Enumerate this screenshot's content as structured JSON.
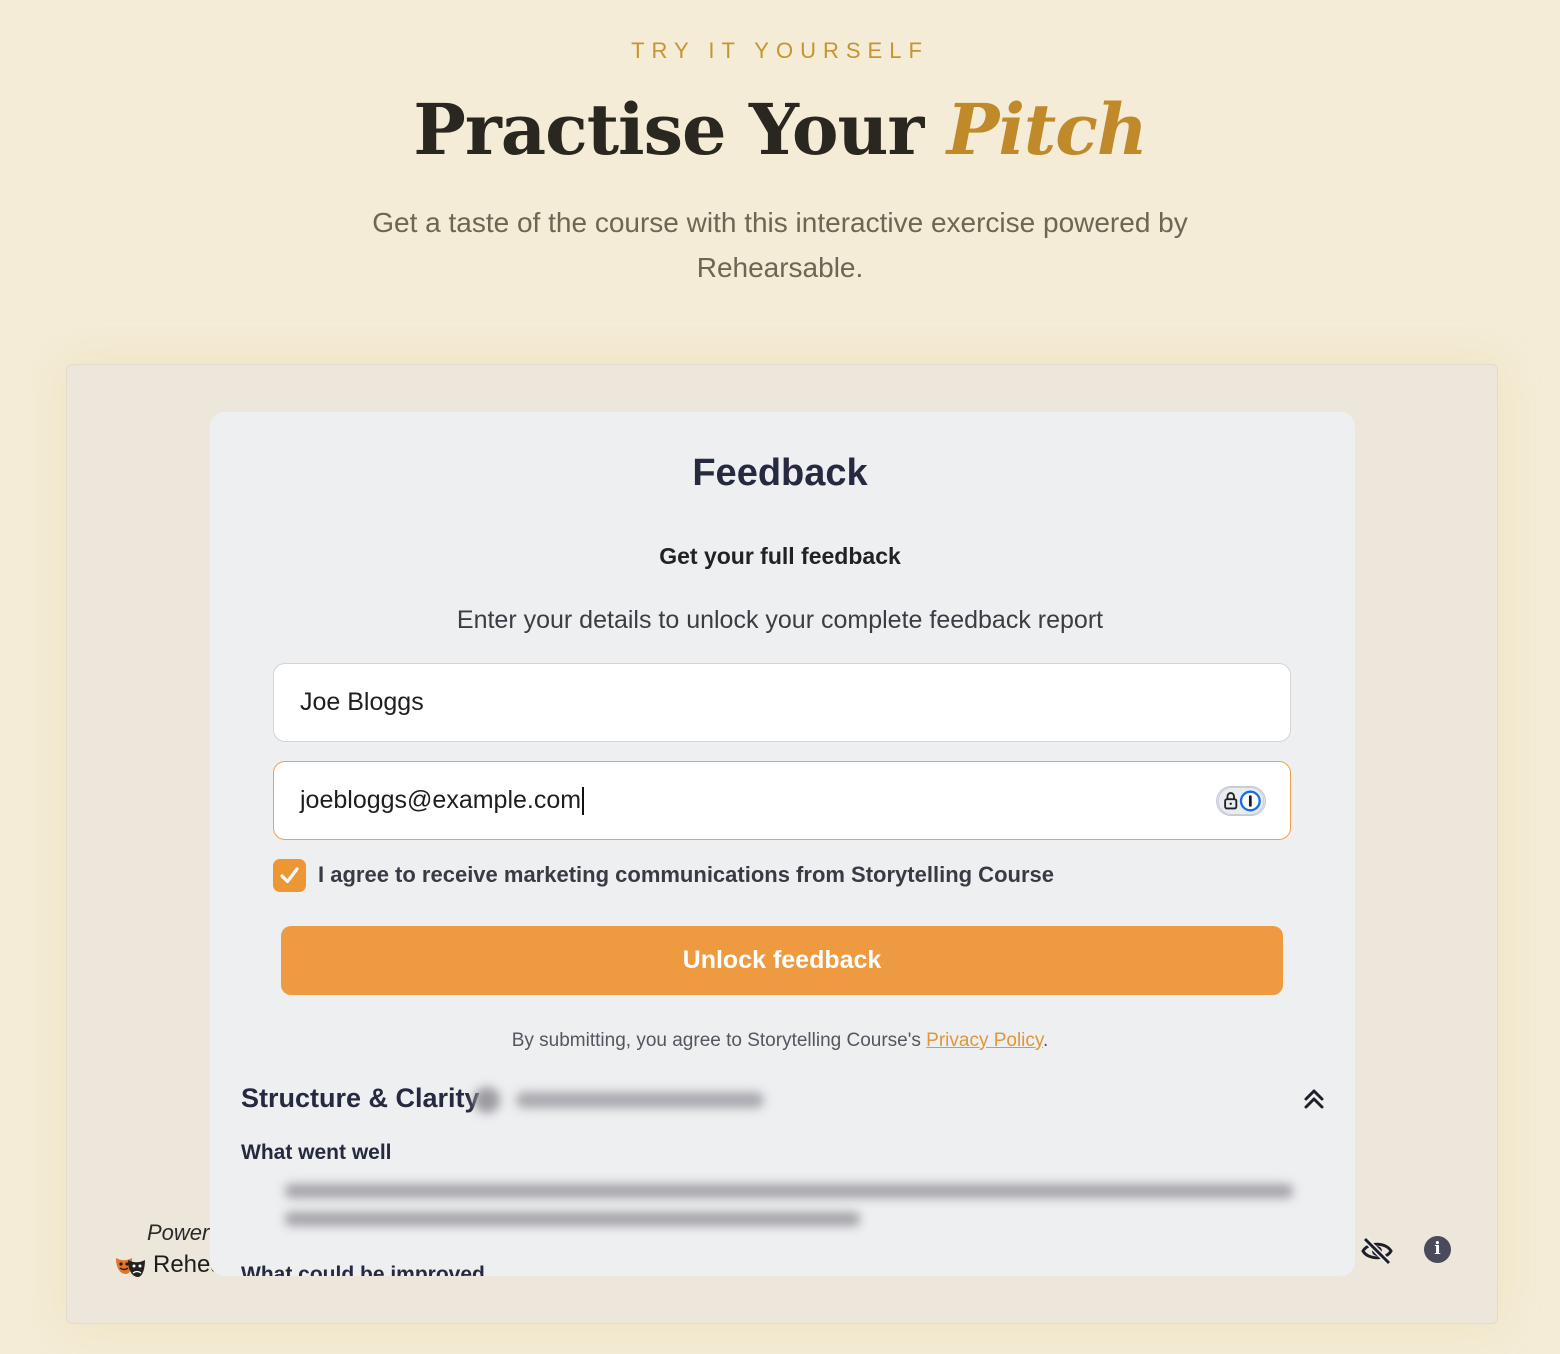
{
  "hero": {
    "eyebrow": "TRY IT YOURSELF",
    "title_main": "Practise Your ",
    "title_accent": "Pitch",
    "subtitle": "Get a taste of the course with this interactive exercise powered by Rehearsable."
  },
  "widget": {
    "powered_label": "Powere",
    "powered_name": "Rehea",
    "icons": [
      "eye-off-icon",
      "info-icon"
    ],
    "info_glyph": "i"
  },
  "card": {
    "title": "Feedback",
    "subtitle": "Get your full feedback",
    "description": "Enter your details to unlock your complete feedback report",
    "name_value": "Joe Bloggs",
    "email_value": "joebloggs@example.com",
    "consent_label": "I agree to receive marketing communications from Storytelling Course",
    "consent_checked": true,
    "unlock_label": "Unlock feedback",
    "legal_prefix": "By submitting, you agree to Storytelling Course's ",
    "legal_link": "Privacy Policy",
    "legal_suffix": "."
  },
  "section": {
    "title": "Structure & Clarity",
    "went_well_label": "What went well",
    "improve_label": "What could be improved"
  },
  "colors": {
    "accent": "#ed9a40",
    "gold": "#c08a2a",
    "page_bg": "#f4ecd6",
    "heading": "#262a40"
  }
}
